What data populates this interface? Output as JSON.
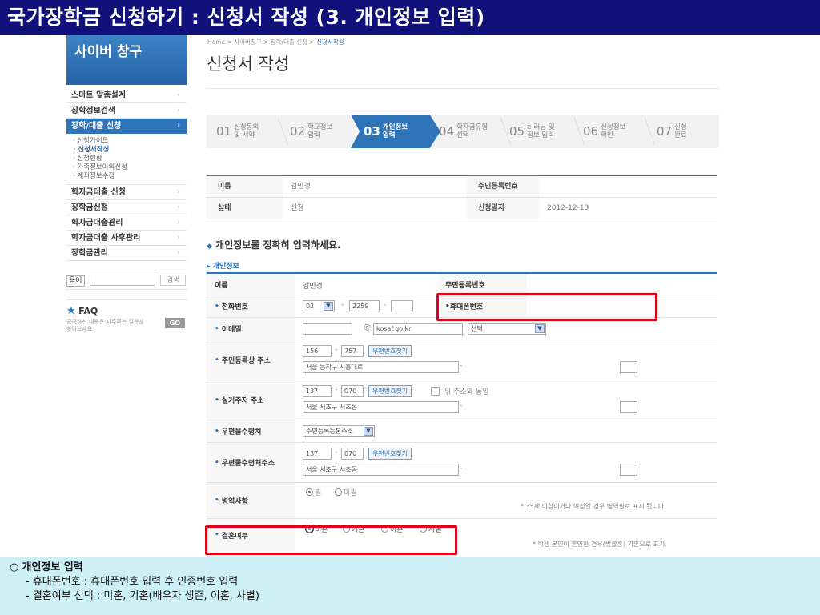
{
  "slide_title": "국가장학금 신청하기 : 신청서 작성 (3. 개인정보 입력)",
  "sidebar": {
    "title": "사이버 창구",
    "menu": [
      {
        "label": "스마트 맞춤설계",
        "active": false
      },
      {
        "label": "장학정보검색",
        "active": false
      },
      {
        "label": "장학/대출 신청",
        "active": true
      }
    ],
    "submenu": [
      {
        "label": "· 신청가이드",
        "active": false
      },
      {
        "label": "· 신청서작성",
        "active": true
      },
      {
        "label": "· 신청현황",
        "active": false
      },
      {
        "label": "· 가족정보이의신청",
        "active": false
      },
      {
        "label": "· 계좌정보수정",
        "active": false
      }
    ],
    "menu2": [
      {
        "label": "학자금대출 신청"
      },
      {
        "label": "장학금신청"
      },
      {
        "label": "학자금대출관리"
      },
      {
        "label": "학자금대출 사후관리"
      },
      {
        "label": "장학금관리"
      }
    ],
    "glossary_label": "용어",
    "glossary_search": "검색",
    "faq_title": "FAQ",
    "faq_desc": "궁금하신 내용은 자주묻는 질문을 찾아보세요",
    "faq_go": "GO"
  },
  "breadcrumb": {
    "path": "Home > 사이버창구 > 장학/대출 신청 > ",
    "current": "신청서작성"
  },
  "page_title": "신청서 작성",
  "steps": [
    {
      "num": "01",
      "label1": "신청동의",
      "label2": "및 서약",
      "active": false
    },
    {
      "num": "02",
      "label1": "학교정보",
      "label2": "입력",
      "active": false
    },
    {
      "num": "03",
      "label1": "개인정보",
      "label2": "입력",
      "active": true
    },
    {
      "num": "04",
      "label1": "학자금유형",
      "label2": "선택",
      "active": false
    },
    {
      "num": "05",
      "label1": "e-러닝 및",
      "label2": "정보 입력",
      "active": false
    },
    {
      "num": "06",
      "label1": "신청정보",
      "label2": "확인",
      "active": false
    },
    {
      "num": "07",
      "label1": "신청",
      "label2": "완료",
      "active": false
    }
  ],
  "applicant": {
    "name_label": "이름",
    "name_value": "김민경",
    "rrn_label": "주민등록번호",
    "rrn_value": "",
    "status_label": "상태",
    "status_value": "신청",
    "date_label": "신청일자",
    "date_value": "2012-12-13"
  },
  "instruction": "개인정보를 정확히 입력하세요.",
  "section_label": "개인정보",
  "form": {
    "name_label": "이름",
    "name_value": "김민경",
    "rrn_label": "주민등록번호",
    "phone_label": "전화번호",
    "phone_area": "02",
    "phone_mid": "2259",
    "phone_last": "",
    "mobile_label": "휴대폰번호",
    "email_label": "이메일",
    "email_id": "",
    "email_domain": "kosaf.go.kr",
    "email_select": "선택",
    "res_addr_label": "주민등록상 주소",
    "res_zip1": "156",
    "res_zip2": "757",
    "zip_btn": "우편번호찾기",
    "res_addr1": "서울 동작구 시흥대로",
    "res_addr2": "",
    "real_addr_label": "실거주지 주소",
    "real_zip1": "137",
    "real_zip2": "070",
    "same_addr_label": "위 주소와 동일",
    "real_addr1": "서울 서초구 서초동",
    "mail_place_label": "우편물수령처",
    "mail_place_value": "주민등록등본주소",
    "mail_addr_label": "우편물수령처주소",
    "mail_zip1": "137",
    "mail_zip2": "070",
    "mail_addr1": "서울 서초구 서초동",
    "military_label": "병역사항",
    "military_opt1": "필",
    "military_opt2": "미필",
    "military_note": "* 35세 이상이거나 여성일 경우 병역필로 표시 됩니다.",
    "marital_label": "결혼여부",
    "marital_opt1": "미혼",
    "marital_opt2": "기혼",
    "marital_opt3": "이혼",
    "marital_opt4": "사별",
    "marital_note": "* 학생 본인이 혼인한 경우(법률혼) 기혼으로 표기."
  },
  "bottom": {
    "bullet": "○",
    "title": "개인정보 입력",
    "line1": "- 휴대폰번호 : 휴대폰번호 입력 후 인증번호 입력",
    "line2": "- 결혼여부 선택 : 미혼, 기혼(배우자 생존, 이혼, 사별)"
  },
  "colors": {
    "title_bar": "#10117a",
    "accent": "#2d75b8",
    "highlight": "#e0001a",
    "bottom_panel": "#ccf0f6"
  }
}
